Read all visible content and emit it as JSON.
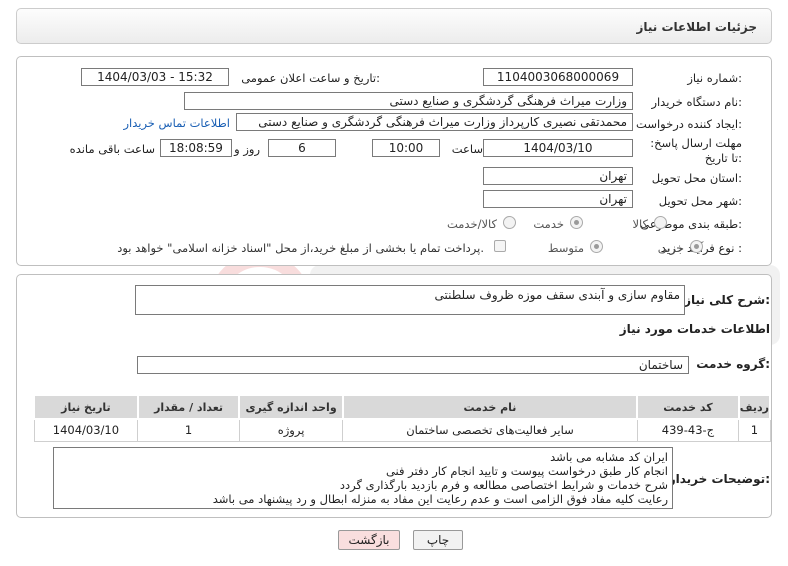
{
  "header": {
    "title": "جزئیات اطلاعات نیاز"
  },
  "fields": {
    "need_number_label": "شماره نیاز:",
    "need_number": "1104003068000069",
    "announce_label": "تاریخ و ساعت اعلان عمومی:",
    "announce_value": "1404/03/03 - 15:32",
    "buyer_org_label": "نام دستگاه خریدار:",
    "buyer_org": "وزارت میراث فرهنگی  گردشگری و صنایع دستی",
    "creator_label": "ایجاد کننده درخواست:",
    "creator": "محمدتقی نصیری کارپرداز وزارت میراث فرهنگی  گردشگری و صنایع دستی",
    "contact_link": "اطلاعات تماس خریدار",
    "deadline_label": "مهلت ارسال پاسخ: تا تاریخ:",
    "deadline_date": "1404/03/10",
    "time_label": "ساعت",
    "deadline_time": "10:00",
    "days_value": "6",
    "days_label": "روز و",
    "remaining_time": "18:08:59",
    "remaining_label": "ساعت باقی مانده",
    "province_label": "استان محل تحویل:",
    "province": "تهران",
    "city_label": "شهر محل تحویل:",
    "city": "تهران",
    "category_label": "طبقه بندی موضوعی:",
    "category_options": [
      "کالا",
      "خدمت",
      "کالا/خدمت"
    ],
    "category_selected": "خدمت",
    "purchase_type_label": "نوع فرآیند خرید :",
    "purchase_options": [
      "جزیی",
      "متوسط"
    ],
    "purchase_selected": "جزیی",
    "payment_note": "پرداخت تمام یا بخشی از مبلغ خرید،از محل \"اسناد خزانه اسلامی\" خواهد بود."
  },
  "summary": {
    "label": "شرح کلی نیاز:",
    "value": "مقاوم سازی و آبندی سقف موزه ظروف سلطنتی"
  },
  "services": {
    "title": "اطلاعات خدمات مورد نیاز",
    "group_label": "گروه خدمت:",
    "group_value": "ساختمان",
    "columns": [
      "ردیف",
      "کد خدمت",
      "نام خدمت",
      "واحد اندازه گیری",
      "تعداد / مقدار",
      "تاریخ نیاز"
    ],
    "rows": [
      {
        "row": "1",
        "code": "ج-43-439",
        "name": "سایر فعالیت‌های تخصصی ساختمان",
        "unit": "پروژه",
        "qty": "1",
        "date": "1404/03/10"
      }
    ]
  },
  "notes": {
    "label": "توضیحات خریدار:",
    "lines": [
      "ایران کد مشابه می باشد",
      "انجام کار طبق درخواست پیوست و تایید انجام کار دفتر فنی",
      "شرح خدمات و شرایط اختصاصی مطالعه و فرم بازدید بارگذاری گردد",
      "رعایت کلیه مفاد فوق الزامی است و عدم رعایت این مفاد به منزله ابطال و رد پیشنهاد می باشد"
    ]
  },
  "buttons": {
    "print": "چاپ",
    "back": "بازگشت"
  },
  "colors": {
    "back_button": "#f9dede",
    "header_bg": "#ececec",
    "link": "#1a5fb4"
  }
}
